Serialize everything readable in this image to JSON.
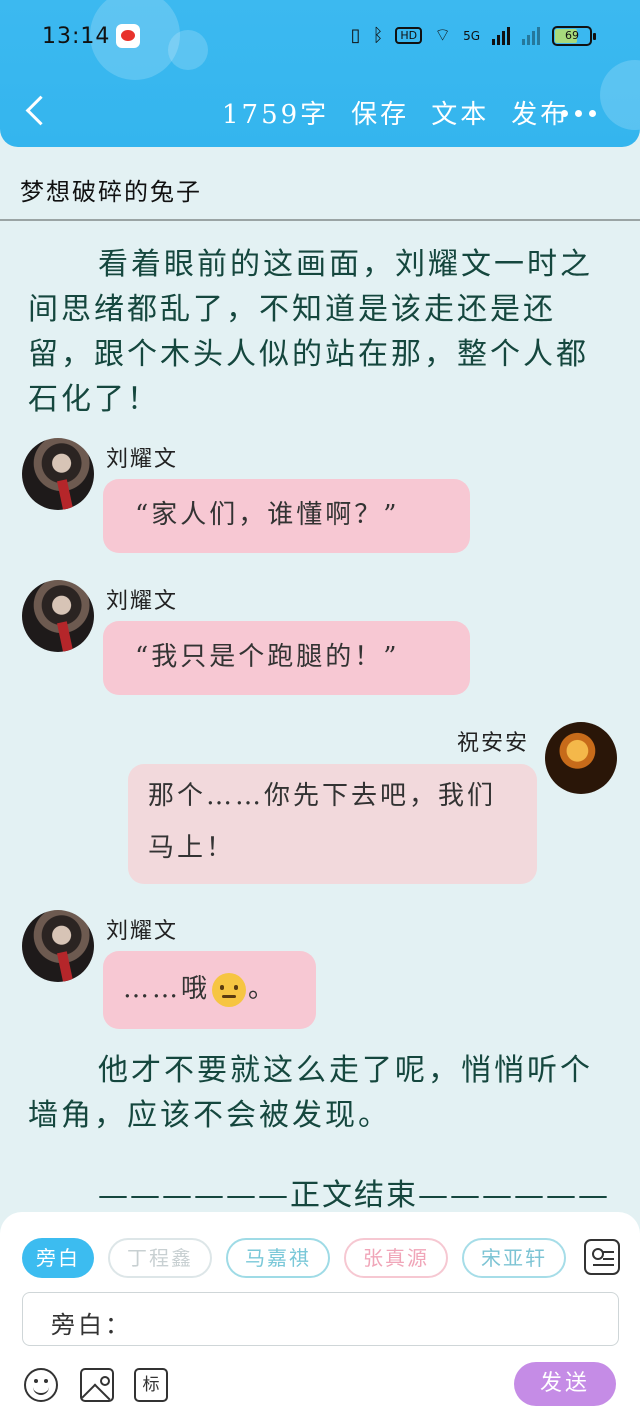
{
  "status_bar": {
    "time": "13:14",
    "wifi": "HD",
    "network": "5G",
    "battery": "69"
  },
  "header": {
    "word_count": "1759字",
    "save": "保存",
    "text": "文本",
    "publish": "发布"
  },
  "story": {
    "title": "梦想破碎的兔子"
  },
  "content": {
    "narration1": "看着眼前的这画面，刘耀文一时之间思绪都乱了，不知道是该走还是还留，跟个木头人似的站在那，整个人都石化了！",
    "messages": [
      {
        "sender": "刘耀文",
        "text": "“家人们，谁懂啊？”"
      },
      {
        "sender": "刘耀文",
        "text": "“我只是个跑腿的！”"
      },
      {
        "sender": "祝安安",
        "text": "那个……你先下去吧，我们马上！"
      },
      {
        "sender": "刘耀文",
        "text_before": "……哦",
        "text_after": "。"
      }
    ],
    "narration2": "他才不要就这么走了呢，悄悄听个墙角，应该不会被发现。",
    "ending": "——————正文结束——————"
  },
  "composer": {
    "roles": [
      "旁白",
      "丁程鑫",
      "马嘉祺",
      "张真源",
      "宋亚轩"
    ],
    "input_label": "旁白：",
    "tag_icon_text": "标",
    "send": "发送"
  },
  "colors": {
    "header": "#3cb9f0",
    "background": "#e3f1f3",
    "bubble_pink": "#f7c8d3",
    "bubble_rose": "#f2d9dc",
    "send": "#c58ce6",
    "text_green": "#15473e"
  }
}
